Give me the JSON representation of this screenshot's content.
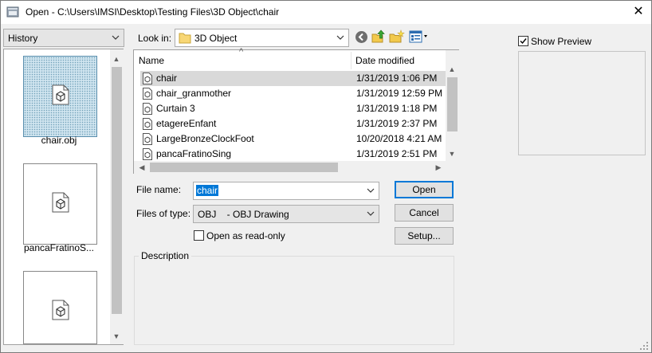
{
  "window": {
    "title": "Open - C:\\Users\\IMSI\\Desktop\\Testing Files\\3D Object\\chair",
    "close_glyph": "✕"
  },
  "history": {
    "dropdown_value": "History",
    "items": [
      {
        "label": "chair.obj",
        "selected": true
      },
      {
        "label": "pancaFratinoS...",
        "selected": false
      },
      {
        "label": "",
        "selected": false
      }
    ]
  },
  "look_in": {
    "label": "Look in:",
    "value": "3D Object"
  },
  "toolbar": {
    "icons": [
      "back-icon",
      "up-folder-icon",
      "new-folder-icon",
      "view-menu-icon"
    ]
  },
  "file_list": {
    "columns": [
      "Name",
      "Date modified"
    ],
    "sort_glyph": "^",
    "rows": [
      {
        "name": "chair",
        "date": "1/31/2019 1:06 PM",
        "selected": true
      },
      {
        "name": "chair_granmother",
        "date": "1/31/2019 12:59 PM",
        "selected": false
      },
      {
        "name": "Curtain 3",
        "date": "1/31/2019 1:18 PM",
        "selected": false
      },
      {
        "name": "etagereEnfant",
        "date": "1/31/2019 2:37 PM",
        "selected": false
      },
      {
        "name": "LargeBronzeClockFoot",
        "date": "10/20/2018 4:21 AM",
        "selected": false
      },
      {
        "name": "pancaFratinoSing",
        "date": "1/31/2019 2:51 PM",
        "selected": false
      }
    ]
  },
  "form": {
    "file_name_label": "File name:",
    "file_name_value": "chair",
    "file_type_label": "Files of type:",
    "file_type_value": "OBJ    - OBJ Drawing",
    "readonly_label": "Open as read-only",
    "readonly_checked": false,
    "description_label": "Description"
  },
  "buttons": {
    "open": "Open",
    "cancel": "Cancel",
    "setup": "Setup..."
  },
  "preview": {
    "label": "Show Preview",
    "checked": true
  },
  "colors": {
    "selection_blue": "#0078d7",
    "row_selected": "#d9d9d9"
  }
}
